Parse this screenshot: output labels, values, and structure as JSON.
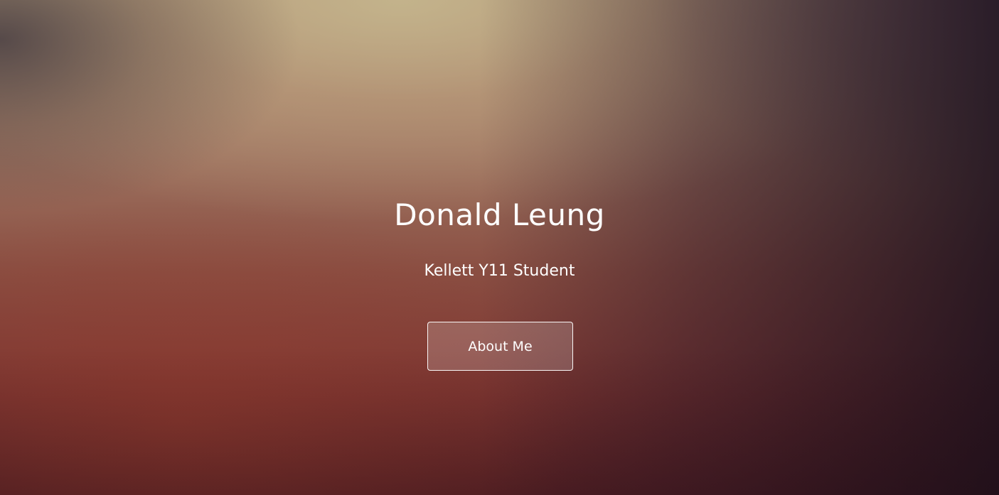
{
  "hero": {
    "name": "Donald Leung",
    "tagline": "Kellett Y11 Student",
    "cta_label": "About Me"
  },
  "colors": {
    "text": "#ffffff",
    "background_top": "#b49f7f",
    "background_bottom": "#5f2428",
    "background_right": "#1f1220"
  }
}
